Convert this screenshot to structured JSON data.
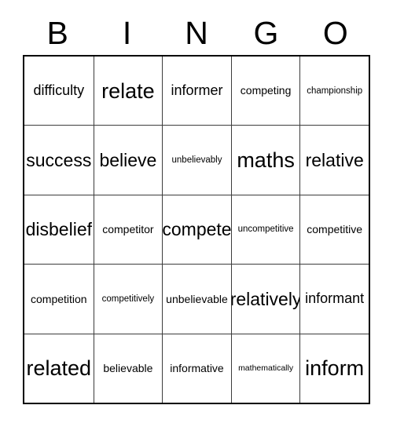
{
  "card": {
    "title": "BINGO",
    "header_letters": [
      "B",
      "I",
      "N",
      "G",
      "O"
    ],
    "columns": 5,
    "rows": 5,
    "border_color": "#000000",
    "grid_line_color": "#3c3c3c",
    "text_color": "#000000",
    "background_color": "#ffffff",
    "cells": [
      [
        {
          "text": "difficulty",
          "size": "md"
        },
        {
          "text": "relate",
          "size": "xl"
        },
        {
          "text": "informer",
          "size": "md"
        },
        {
          "text": "competing",
          "size": "sm"
        },
        {
          "text": "championship",
          "size": "xs"
        }
      ],
      [
        {
          "text": "success",
          "size": "lg"
        },
        {
          "text": "believe",
          "size": "lg"
        },
        {
          "text": "unbelievably",
          "size": "xs"
        },
        {
          "text": "maths",
          "size": "xl"
        },
        {
          "text": "relative",
          "size": "lg"
        }
      ],
      [
        {
          "text": "disbelief",
          "size": "lg"
        },
        {
          "text": "competitor",
          "size": "sm"
        },
        {
          "text": "compete",
          "size": "lg"
        },
        {
          "text": "uncompetitive",
          "size": "xs"
        },
        {
          "text": "competitive",
          "size": "sm"
        }
      ],
      [
        {
          "text": "competition",
          "size": "sm"
        },
        {
          "text": "competitively",
          "size": "xs"
        },
        {
          "text": "unbelievable",
          "size": "sm"
        },
        {
          "text": "relatively",
          "size": "lg"
        },
        {
          "text": "informant",
          "size": "md"
        }
      ],
      [
        {
          "text": "related",
          "size": "xl"
        },
        {
          "text": "believable",
          "size": "sm"
        },
        {
          "text": "informative",
          "size": "sm"
        },
        {
          "text": "mathematically",
          "size": "xxs"
        },
        {
          "text": "inform",
          "size": "xl"
        }
      ]
    ]
  }
}
